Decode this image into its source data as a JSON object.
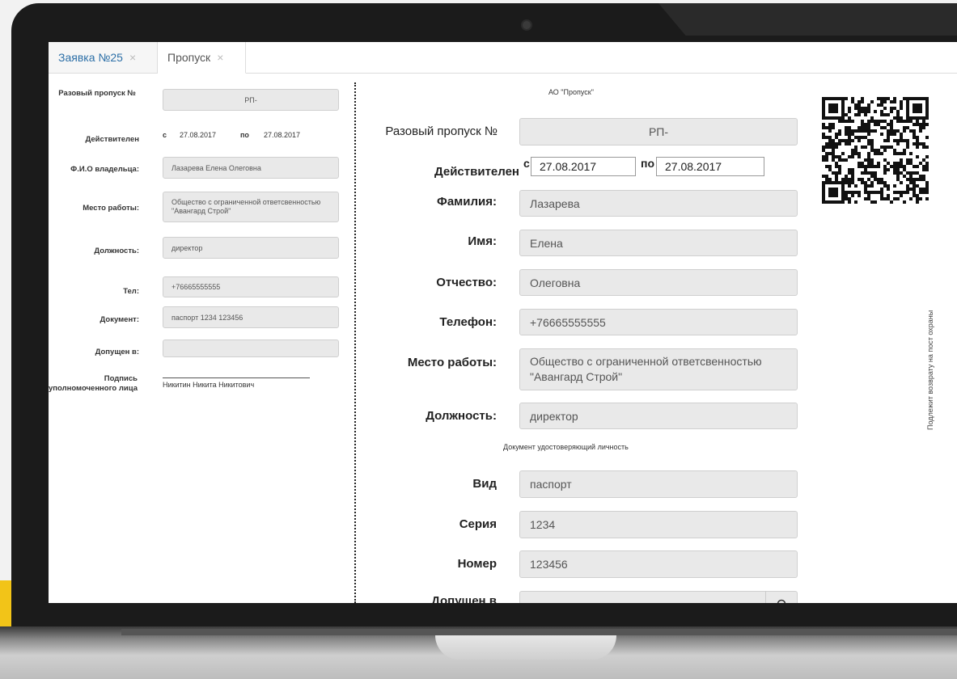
{
  "tabs": [
    {
      "label": "Заявка №25",
      "close": "×"
    },
    {
      "label": "Пропуск",
      "close": "×"
    }
  ],
  "summary": {
    "pass_label": "Разовый пропуск №",
    "pass_value": "РП-",
    "valid_label": "Действителен",
    "valid_from_prefix": "с",
    "valid_from": "27.08.2017",
    "valid_to_prefix": "по",
    "valid_to": "27.08.2017",
    "owner_label": "Ф.И.О владельца:",
    "owner_value": "Лазарева Елена Олеговна",
    "work_label": "Место работы:",
    "work_value": "Общество с ограниченной ответсвенностью \"Авангард Строй\"",
    "position_label": "Должность:",
    "position_value": "директор",
    "phone_label": "Тел:",
    "phone_value": "+76665555555",
    "document_label": "Документ:",
    "document_value": "паспорт 1234 123456",
    "admitted_label": "Допущен в:",
    "admitted_value": "",
    "signature_label": "Подпись уполномоченного лица",
    "signature_value": "Никитин Никита Никитович"
  },
  "form": {
    "org": "АО \"Пропуск\"",
    "pass_label": "Разовый пропуск №",
    "pass_value": "РП-",
    "valid_label": "Действителен",
    "valid_from_prefix": "с",
    "valid_from": "27.08.2017",
    "valid_to_prefix": "по",
    "valid_to": "27.08.2017",
    "surname_label": "Фамилия:",
    "surname_value": "Лазарева",
    "name_label": "Имя:",
    "name_value": "Елена",
    "patronymic_label": "Отчество:",
    "patronymic_value": "Олеговна",
    "phone_label": "Телефон:",
    "phone_value": "+76665555555",
    "work_label": "Место работы:",
    "work_value": "Общество с ограниченной ответсвенностью \"Авангард Строй\"",
    "position_label": "Должность:",
    "position_value": "директор",
    "doc_section": "Документ удостоверяющий личность",
    "doc_type_label": "Вид",
    "doc_type_value": "паспорт",
    "series_label": "Серия",
    "series_value": "1234",
    "number_label": "Номер",
    "number_value": "123456",
    "admitted_label": "Допущен в",
    "admitted_value": "",
    "return_note": "Подлежит возврату на пост охраны"
  },
  "icons": {
    "qr": "qr-code",
    "search": "search-icon"
  }
}
